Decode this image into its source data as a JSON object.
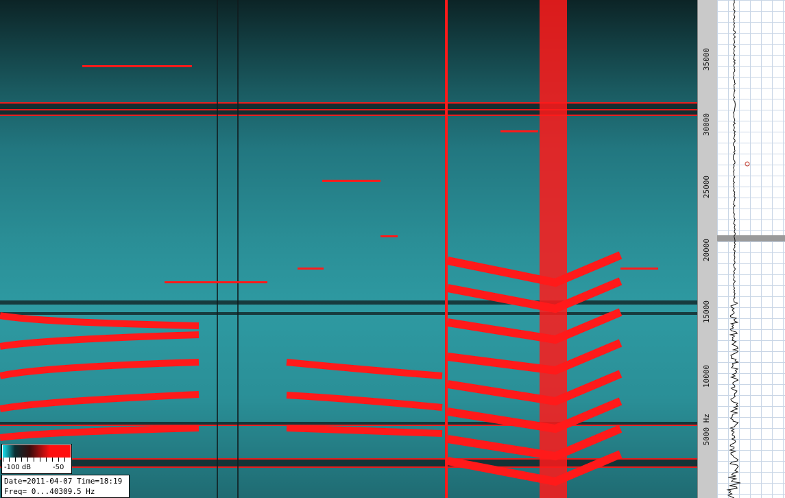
{
  "colors": {
    "noise": "#2a8e96",
    "harmonic": "#ff1a1a",
    "dark_band": "#101c1e",
    "axis_bg": "#c9c9c9",
    "trace_line": "#111111"
  },
  "freq_axis": {
    "ticks": [
      "35000",
      "30000",
      "25000",
      "20000",
      "15000",
      "10000",
      "5000 Hz"
    ]
  },
  "colorbar": {
    "min_label": "-100 dB",
    "max_label": "-50"
  },
  "info": {
    "line1": "Date=2011-04-07 Time=18:19",
    "line2": "Freq= 0...40309.5 Hz"
  }
}
